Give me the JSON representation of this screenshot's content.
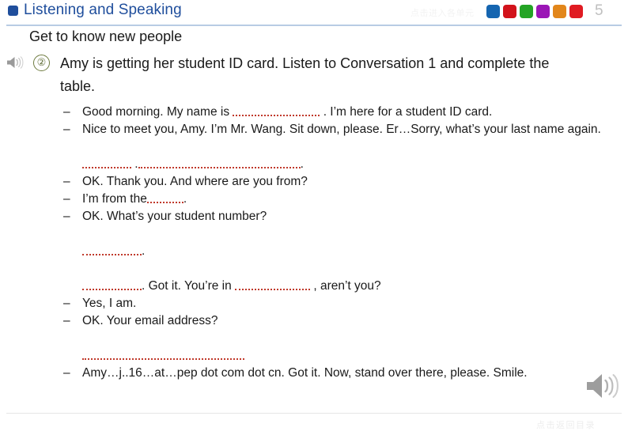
{
  "header": {
    "title": "Listening and Speaking",
    "title_square_color": "#1f4e9c",
    "nav_hint": "点击进入各单元",
    "page_number": "5",
    "chips": [
      {
        "name": "chip-blue",
        "color": "#1565b0"
      },
      {
        "name": "chip-red",
        "color": "#d2131b"
      },
      {
        "name": "chip-green",
        "color": "#24a425"
      },
      {
        "name": "chip-purple",
        "color": "#9b16b6"
      },
      {
        "name": "chip-orange",
        "color": "#e2861a"
      },
      {
        "name": "chip-red2",
        "color": "#e01b22"
      }
    ]
  },
  "subtitle": "Get to know new people",
  "task": {
    "number": "②",
    "speaker_icon": "speaker-icon",
    "text": "Amy is getting her student ID card. Listen to Conversation 1 and complete the table."
  },
  "dialogue": {
    "dash": "–",
    "lines": [
      {
        "type": "speech",
        "parts": [
          {
            "kind": "text",
            "value": "Good morning. My name is "
          },
          {
            "kind": "blank",
            "size": "b-xl"
          },
          {
            "kind": "text",
            "value": " . I’m here for a student ID card."
          }
        ]
      },
      {
        "type": "speech",
        "parts": [
          {
            "kind": "text",
            "value": "Nice to meet you, Amy. I’m Mr. Wang. Sit down, please. Er…Sorry, what’s your last name again."
          }
        ]
      },
      {
        "type": "answer",
        "parts": [
          {
            "kind": "blank",
            "size": "b-sm"
          },
          {
            "kind": "text",
            "value": " ."
          },
          {
            "kind": "blank",
            "size": "b-xxl"
          },
          {
            "kind": "text",
            "value": "."
          }
        ]
      },
      {
        "type": "speech",
        "parts": [
          {
            "kind": "text",
            "value": "OK. Thank you. And where are you from?"
          }
        ]
      },
      {
        "type": "speech",
        "parts": [
          {
            "kind": "text",
            "value": "I’m from the"
          },
          {
            "kind": "blank",
            "size": "b-xs"
          },
          {
            "kind": "text",
            "value": "."
          }
        ]
      },
      {
        "type": "speech",
        "parts": [
          {
            "kind": "text",
            "value": "OK. What’s your student number?"
          }
        ]
      },
      {
        "type": "answer",
        "parts": [
          {
            "kind": "blank",
            "size": "b-md"
          },
          {
            "kind": "text",
            "value": "."
          }
        ]
      },
      {
        "type": "answer",
        "parts": [
          {
            "kind": "blank",
            "size": "b-md"
          },
          {
            "kind": "text",
            "value": ". Got it. You’re in "
          },
          {
            "kind": "blank",
            "size": "b-lg"
          },
          {
            "kind": "text",
            "value": " , aren’t you?"
          }
        ]
      },
      {
        "type": "speech",
        "parts": [
          {
            "kind": "text",
            "value": "Yes, I am."
          }
        ]
      },
      {
        "type": "speech",
        "parts": [
          {
            "kind": "text",
            "value": "OK. Your email address?"
          }
        ]
      },
      {
        "type": "answer",
        "parts": [
          {
            "kind": "blank",
            "size": "b-xxl2"
          }
        ]
      },
      {
        "type": "speech",
        "parts": [
          {
            "kind": "text",
            "value": "Amy…j..16…at…pep dot com dot cn. Got it. Now, stand over there, please. Smile."
          }
        ]
      }
    ]
  },
  "footer": {
    "text": "点击返回目录",
    "speaker_icon": "speaker-icon"
  }
}
